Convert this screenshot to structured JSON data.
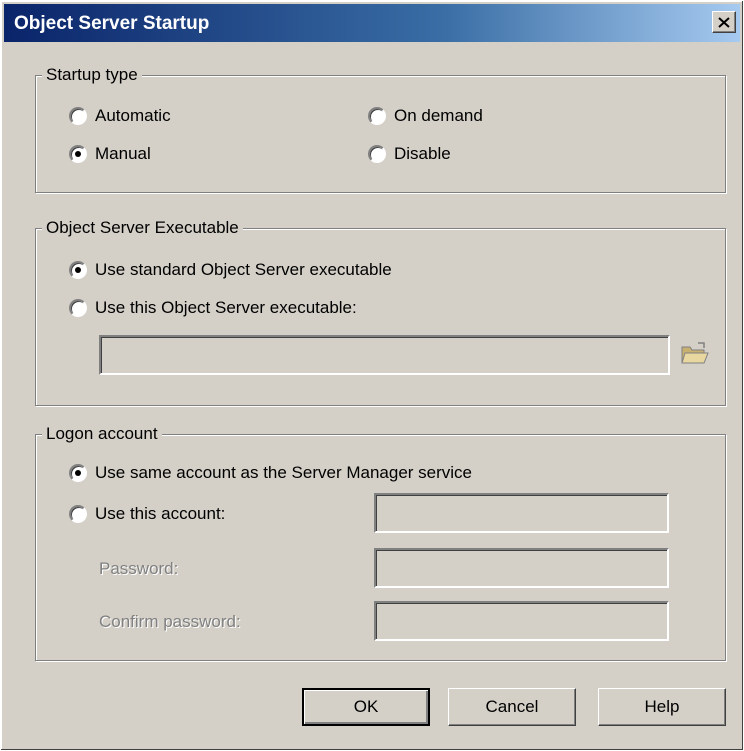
{
  "window": {
    "title": "Object Server Startup"
  },
  "startup_type": {
    "legend": "Startup type",
    "options": {
      "automatic": {
        "label": "Automatic",
        "selected": false
      },
      "manual": {
        "label": "Manual",
        "selected": true
      },
      "on_demand": {
        "label": "On demand",
        "selected": false
      },
      "disable": {
        "label": "Disable",
        "selected": false
      }
    }
  },
  "executable": {
    "legend": "Object Server Executable",
    "options": {
      "standard": {
        "label": "Use standard Object Server executable",
        "selected": true
      },
      "custom": {
        "label": "Use this Object Server executable:",
        "selected": false
      }
    },
    "path_value": ""
  },
  "logon": {
    "legend": "Logon account",
    "options": {
      "same": {
        "label": "Use same account as the Server Manager service",
        "selected": true
      },
      "this": {
        "label": "Use this account:",
        "selected": false
      }
    },
    "account_value": "",
    "password_label": "Password:",
    "password_value": "",
    "confirm_label": "Confirm password:",
    "confirm_value": ""
  },
  "buttons": {
    "ok": "OK",
    "cancel": "Cancel",
    "help": "Help"
  },
  "icons": {
    "close": "close-icon",
    "browse": "folder-open-icon"
  }
}
